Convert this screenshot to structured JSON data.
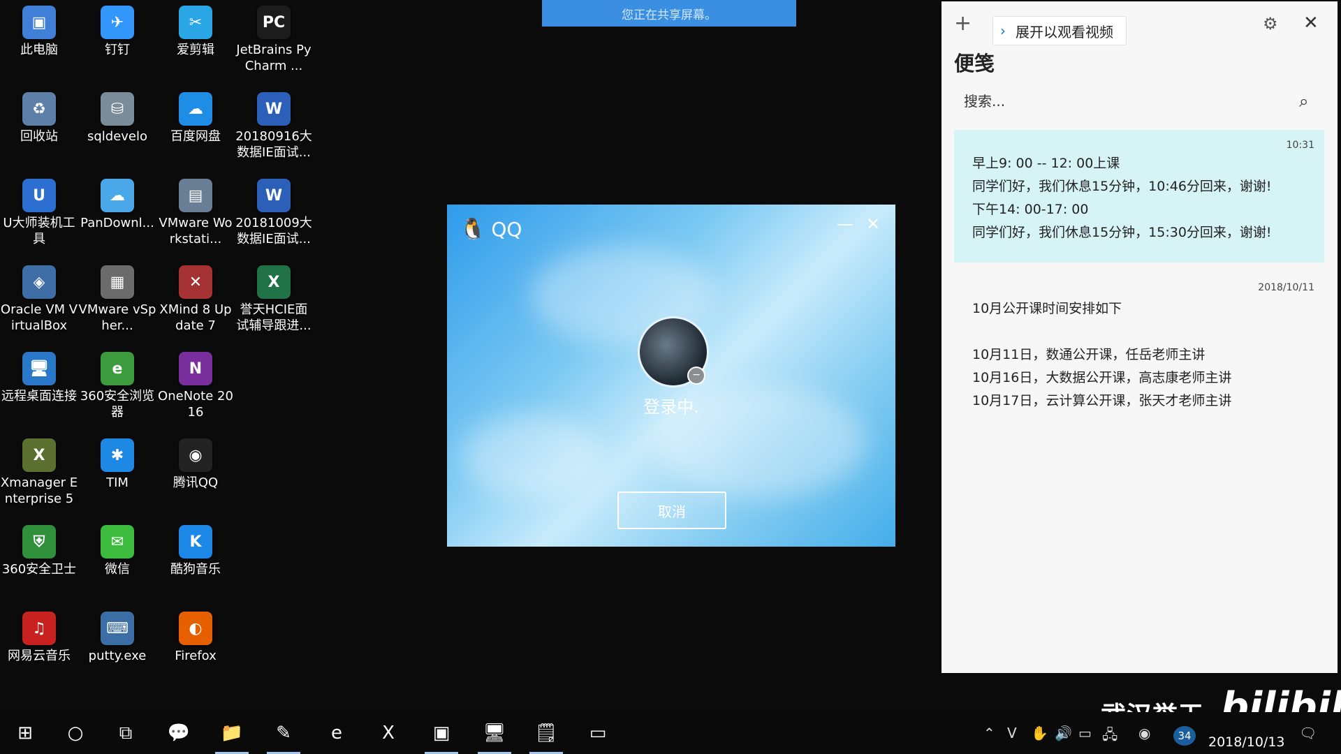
{
  "share_banner": "您正在共享屏幕。",
  "desktop_icons": [
    {
      "label": "此电脑",
      "icon": "computer-icon",
      "color": "#3f7fd6",
      "glyph": "▣"
    },
    {
      "label": "钉钉",
      "icon": "dingtalk-icon",
      "color": "#3296fa",
      "glyph": "✈"
    },
    {
      "label": "爱剪辑",
      "icon": "aijianji-icon",
      "color": "#2aa5e5",
      "glyph": "✂"
    },
    {
      "label": "JetBrains PyCharm ...",
      "icon": "pycharm-icon",
      "color": "#1c1c1c",
      "glyph": "PC"
    },
    {
      "label": "回收站",
      "icon": "recycle-bin-icon",
      "color": "#5d7fa8",
      "glyph": "♻"
    },
    {
      "label": "sqldevelo",
      "icon": "sqldeveloper-icon",
      "color": "#7a8c99",
      "glyph": "⛁"
    },
    {
      "label": "百度网盘",
      "icon": "baidu-netdisk-icon",
      "color": "#1e8de6",
      "glyph": "☁"
    },
    {
      "label": "20180916大数据IE面试...",
      "icon": "word-document-icon",
      "color": "#2b5fb8",
      "glyph": "W"
    },
    {
      "label": "U大师装机工具",
      "icon": "udashi-icon",
      "color": "#2d6fd1",
      "glyph": "U"
    },
    {
      "label": "PanDownl...",
      "icon": "pandownload-icon",
      "color": "#4aa8e8",
      "glyph": "☁"
    },
    {
      "label": "VMware Workstati...",
      "icon": "vmware-workstation-icon",
      "color": "#6a7f96",
      "glyph": "▤"
    },
    {
      "label": "20181009大数据IE面试...",
      "icon": "word-document-icon",
      "color": "#2b5fb8",
      "glyph": "W"
    },
    {
      "label": "Oracle VM VirtualBox",
      "icon": "virtualbox-icon",
      "color": "#3f6ea6",
      "glyph": "◈"
    },
    {
      "label": "VMware vSpher...",
      "icon": "vmware-vsphere-icon",
      "color": "#6b6b6b",
      "glyph": "▦"
    },
    {
      "label": "XMind 8 Update 7",
      "icon": "xmind-icon",
      "color": "#a53232",
      "glyph": "✕"
    },
    {
      "label": "誉天HCIE面试辅导跟进...",
      "icon": "excel-document-icon",
      "color": "#1f7246",
      "glyph": "X"
    },
    {
      "label": "远程桌面连接",
      "icon": "remote-desktop-icon",
      "color": "#2a78c8",
      "glyph": "🖥"
    },
    {
      "label": "360安全浏览器",
      "icon": "360-browser-icon",
      "color": "#3c9b3c",
      "glyph": "e"
    },
    {
      "label": "OneNote 2016",
      "icon": "onenote-icon",
      "color": "#7b2f9e",
      "glyph": "N"
    },
    {
      "label": "Xmanager Enterprise 5",
      "icon": "xmanager-icon",
      "color": "#5b6f2f",
      "glyph": "X"
    },
    {
      "label": "TIM",
      "icon": "tim-icon",
      "color": "#1e88e5",
      "glyph": "✱"
    },
    {
      "label": "腾讯QQ",
      "icon": "qq-icon",
      "color": "#222222",
      "glyph": "◉"
    },
    {
      "label": "360安全卫士",
      "icon": "360-safe-icon",
      "color": "#2f8f3a",
      "glyph": "⛨"
    },
    {
      "label": "微信",
      "icon": "wechat-icon",
      "color": "#3dbb3d",
      "glyph": "✉"
    },
    {
      "label": "酷狗音乐",
      "icon": "kugou-icon",
      "color": "#1b87e6",
      "glyph": "K"
    },
    {
      "label": "网易云音乐",
      "icon": "netease-music-icon",
      "color": "#c7221f",
      "glyph": "♫"
    },
    {
      "label": "putty.exe",
      "icon": "putty-icon",
      "color": "#3b6ea5",
      "glyph": "⌨"
    },
    {
      "label": "Firefox",
      "icon": "firefox-icon",
      "color": "#e66000",
      "glyph": "◐"
    }
  ],
  "qq_window": {
    "title": "QQ",
    "minimize": "—",
    "close": "✕",
    "status_text": "登录中.",
    "cancel_label": "取消"
  },
  "sticky_notes": {
    "add": "+",
    "expand_label": "展开以观看视频",
    "title": "便笺",
    "search_placeholder": "搜索...",
    "notes": [
      {
        "timestamp": "10:31",
        "lines": [
          "早上9: 00 -- 12: 00上课",
          "同学们好，我们休息15分钟，10:46分回来，谢谢!",
          "下午14: 00-17: 00",
          "同学们好，我们休息15分钟，15:30分回来，谢谢!"
        ]
      },
      {
        "timestamp": "2018/10/11",
        "lines": [
          "10月公开课时间安排如下",
          "",
          "10月11日，数通公开课，任岳老师主讲",
          "10月16日，大数据公开课，高志康老师主讲",
          "10月17日，云计算公开课，张天才老师主讲"
        ]
      }
    ]
  },
  "watermark": {
    "text": "武汉誉天",
    "logo": "bilibili"
  },
  "taskbar": {
    "apps": [
      {
        "icon": "windows-start-icon",
        "glyph": "⊞",
        "active": false
      },
      {
        "icon": "cortana-search-icon",
        "glyph": "○",
        "active": false
      },
      {
        "icon": "task-view-icon",
        "glyph": "⧉",
        "active": false
      },
      {
        "icon": "feedback-icon",
        "glyph": "💬",
        "active": false
      },
      {
        "icon": "file-explorer-icon",
        "glyph": "📁",
        "active": true
      },
      {
        "icon": "notepad-icon",
        "glyph": "✎",
        "active": true
      },
      {
        "icon": "360-browser-taskbar-icon",
        "glyph": "e",
        "active": false
      },
      {
        "icon": "excel-taskbar-icon",
        "glyph": "X",
        "active": false
      },
      {
        "icon": "vmware-taskbar-icon",
        "glyph": "▣",
        "active": true
      },
      {
        "icon": "remote-desktop-taskbar-icon",
        "glyph": "🖥",
        "active": true
      },
      {
        "icon": "sticky-notes-taskbar-icon",
        "glyph": "🗒",
        "active": true
      },
      {
        "icon": "terminal-taskbar-icon",
        "glyph": "▭",
        "active": false
      }
    ],
    "tray_icons": [
      "chevron-up-icon",
      "vmware-tray-icon",
      "touch-icon",
      "volume-icon",
      "battery-icon",
      "network-icon",
      "qq-tray-icon"
    ],
    "notification_count": "34",
    "date": "2018/10/13"
  }
}
